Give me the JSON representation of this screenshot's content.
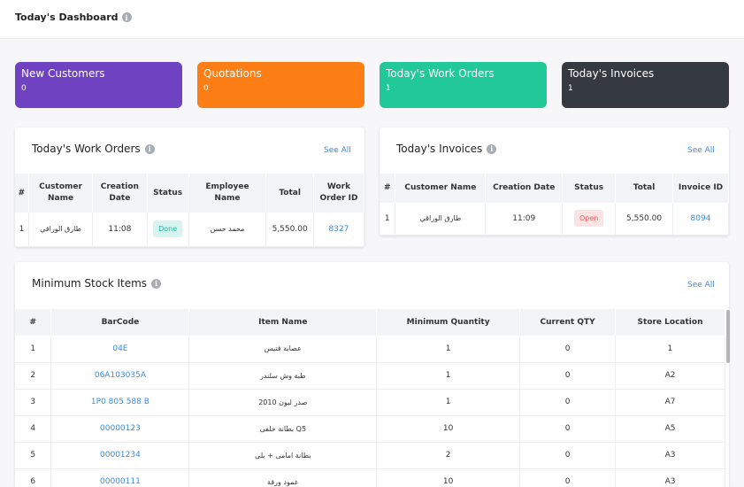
{
  "header": {
    "title": "Today's Dashboard",
    "info_icon": "i"
  },
  "stats": [
    {
      "label": "New Customers",
      "value": "0",
      "color": "#6f42c1"
    },
    {
      "label": "Quotations",
      "value": "0",
      "color": "#fd7e14"
    },
    {
      "label": "Today's Work Orders",
      "value": "1",
      "color": "#20c997"
    },
    {
      "label": "Today's Invoices",
      "value": "1",
      "color": "#343a40"
    }
  ],
  "work_orders": {
    "title": "Today's Work Orders",
    "see_all": "See All",
    "columns": [
      "#",
      "Customer Name",
      "Creation Date",
      "Status",
      "Employee Name",
      "Total",
      "Work Order ID"
    ],
    "rows": [
      {
        "num": "1",
        "customer": "طارق الوراقي",
        "date": "11:08",
        "status": "Done",
        "employee": "محمد حسن",
        "total": "5,550.00",
        "id": "8327"
      }
    ]
  },
  "invoices": {
    "title": "Today's Invoices",
    "see_all": "See All",
    "columns": [
      "#",
      "Customer Name",
      "Creation Date",
      "Status",
      "Total",
      "Invoice ID"
    ],
    "rows": [
      {
        "num": "1",
        "customer": "طارق الوراقي",
        "date": "11:09",
        "status": "Open",
        "total": "5,550.00",
        "id": "8094"
      }
    ]
  },
  "stock": {
    "title": "Minimum Stock Items",
    "see_all": "See All",
    "columns": [
      "#",
      "BarCode",
      "Item Name",
      "Minimum Quantity",
      "Current QTY",
      "Store Location"
    ],
    "rows": [
      {
        "num": "1",
        "barcode": "04E",
        "name": "عصابة فتيس",
        "min": "1",
        "qty": "0",
        "loc": "1"
      },
      {
        "num": "2",
        "barcode": "06A103035A",
        "name": "طبة وش سلندر",
        "min": "1",
        "qty": "0",
        "loc": "A2"
      },
      {
        "num": "3",
        "barcode": "1P0 805 588 B",
        "name": "صدر ليون 2010",
        "min": "1",
        "qty": "0",
        "loc": "A7"
      },
      {
        "num": "4",
        "barcode": "00000123",
        "name": "بطانة خلفى Q5",
        "min": "10",
        "qty": "0",
        "loc": "A5"
      },
      {
        "num": "5",
        "barcode": "00001234",
        "name": "بطانة امامى + بلى",
        "min": "2",
        "qty": "0",
        "loc": "A3"
      },
      {
        "num": "6",
        "barcode": "00000111",
        "name": "عمود ورقة",
        "min": "10",
        "qty": "0",
        "loc": "A3"
      }
    ]
  }
}
